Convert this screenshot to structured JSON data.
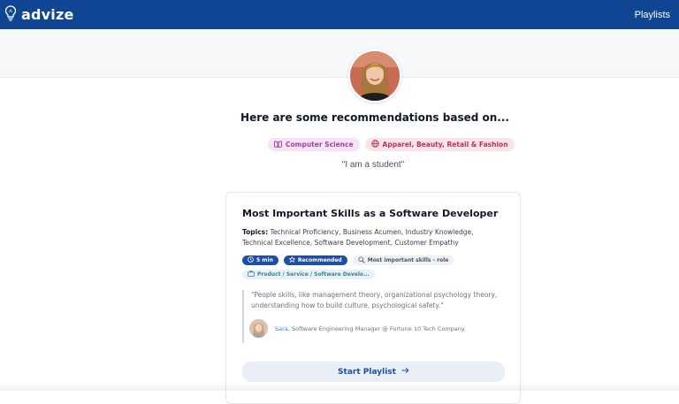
{
  "header": {
    "brand": "advize",
    "nav_playlists": "Playlists",
    "bg_color": "#0f4592"
  },
  "profile": {
    "heading": "Here are some recommendations based on...",
    "tags": [
      {
        "label": "Computer Science",
        "icon": "book-icon"
      },
      {
        "label": "Apparel, Beauty, Retail & Fashion",
        "icon": "globe-icon"
      }
    ],
    "quote": "\"I am a student\""
  },
  "card": {
    "title": "Most Important Skills as a Software Developer",
    "topics_label": "Topics:",
    "topics_text": "Technical Proficiency, Business Acumen, Industry Knowledge, Technical Excellence, Software Development, Customer Empathy",
    "pills": [
      {
        "label": "5 min",
        "icon": "clock-icon"
      },
      {
        "label": "Recommended",
        "icon": "star-icon"
      },
      {
        "label": "Most important skills - role",
        "icon": "search-icon"
      }
    ],
    "category_pill": {
      "label": "Product / Service / Software Develo...",
      "icon": "briefcase-icon"
    },
    "quote": "\"People skills, like management theory, organizational psychology theory, understanding how to build culture, psychological safety.\"",
    "author_name": "Sara,",
    "author_role": "Software Engineering Manager @ Fortune 10 Tech Company",
    "start_label": "Start Playlist",
    "accent_color": "#1d4fa8"
  }
}
